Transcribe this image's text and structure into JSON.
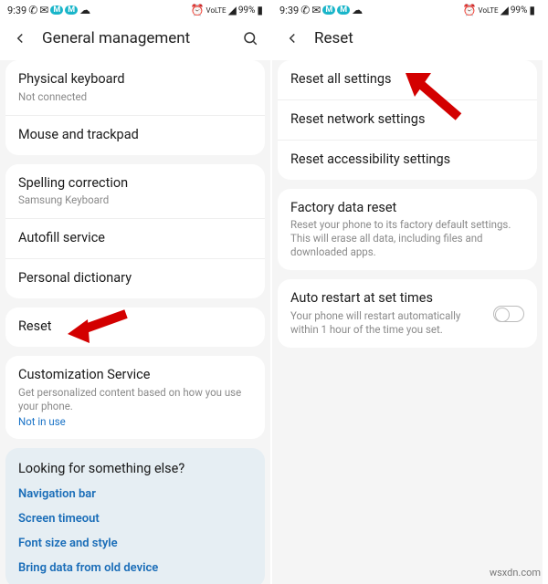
{
  "status": {
    "time": "9:39",
    "battery": "99%"
  },
  "left": {
    "title": "General management",
    "g1": [
      {
        "label": "Physical keyboard",
        "sub": "Not connected"
      },
      {
        "label": "Mouse and trackpad"
      }
    ],
    "g2": [
      {
        "label": "Spelling correction",
        "sub": "Samsung Keyboard"
      },
      {
        "label": "Autofill service"
      },
      {
        "label": "Personal dictionary"
      }
    ],
    "g3": [
      {
        "label": "Reset"
      }
    ],
    "g4": [
      {
        "label": "Customization Service",
        "sub": "Get personalized content based on how you use your phone.",
        "sublink": "Not in use"
      }
    ],
    "help": {
      "heading": "Looking for something else?",
      "links": [
        "Navigation bar",
        "Screen timeout",
        "Font size and style",
        "Bring data from old device"
      ]
    }
  },
  "right": {
    "title": "Reset",
    "g1": [
      {
        "label": "Reset all settings"
      },
      {
        "label": "Reset network settings"
      },
      {
        "label": "Reset accessibility settings"
      }
    ],
    "g2": [
      {
        "label": "Factory data reset",
        "sub": "Reset your phone to its factory default settings. This will erase all data, including files and downloaded apps."
      }
    ],
    "g3": [
      {
        "label": "Auto restart at set times",
        "sub": "Your phone will restart automatically within 1 hour of the time you set."
      }
    ]
  },
  "watermark": "wsxdn.com"
}
